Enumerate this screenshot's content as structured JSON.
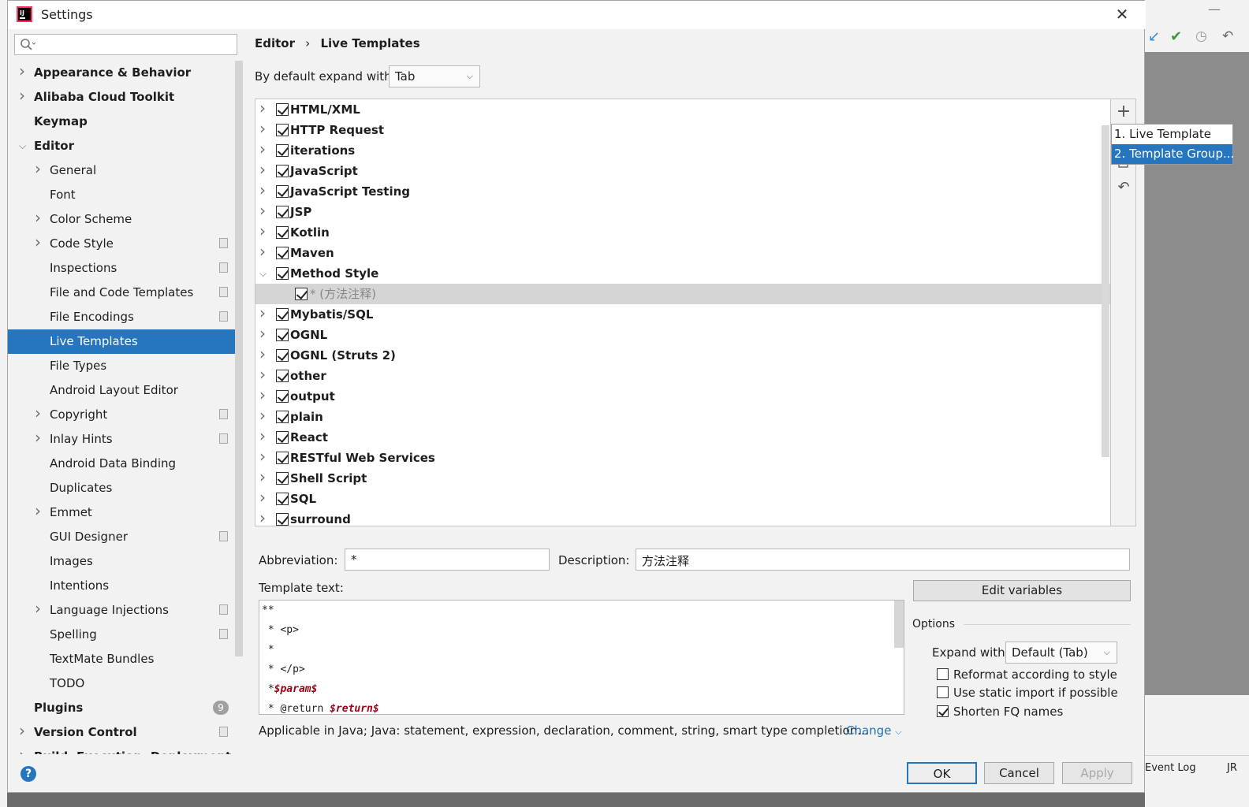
{
  "window": {
    "title": "Settings"
  },
  "search": {
    "placeholder": ""
  },
  "sidebar": {
    "items": [
      {
        "label": "Appearance & Behavior",
        "level": 0,
        "bold": true,
        "chevron": "right"
      },
      {
        "label": "Alibaba Cloud Toolkit",
        "level": 0,
        "bold": true,
        "chevron": "right"
      },
      {
        "label": "Keymap",
        "level": 0,
        "bold": true,
        "chevron": ""
      },
      {
        "label": "Editor",
        "level": 0,
        "bold": true,
        "chevron": "down"
      },
      {
        "label": "General",
        "level": 1,
        "chevron": "right"
      },
      {
        "label": "Font",
        "level": 1,
        "chevron": ""
      },
      {
        "label": "Color Scheme",
        "level": 1,
        "chevron": "right"
      },
      {
        "label": "Code Style",
        "level": 1,
        "chevron": "right",
        "project": true
      },
      {
        "label": "Inspections",
        "level": 1,
        "chevron": "",
        "project": true
      },
      {
        "label": "File and Code Templates",
        "level": 1,
        "chevron": "",
        "project": true
      },
      {
        "label": "File Encodings",
        "level": 1,
        "chevron": "",
        "project": true
      },
      {
        "label": "Live Templates",
        "level": 1,
        "chevron": "",
        "selected": true
      },
      {
        "label": "File Types",
        "level": 1,
        "chevron": ""
      },
      {
        "label": "Android Layout Editor",
        "level": 1,
        "chevron": ""
      },
      {
        "label": "Copyright",
        "level": 1,
        "chevron": "right",
        "project": true
      },
      {
        "label": "Inlay Hints",
        "level": 1,
        "chevron": "right",
        "project": true
      },
      {
        "label": "Android Data Binding",
        "level": 1,
        "chevron": ""
      },
      {
        "label": "Duplicates",
        "level": 1,
        "chevron": ""
      },
      {
        "label": "Emmet",
        "level": 1,
        "chevron": "right"
      },
      {
        "label": "GUI Designer",
        "level": 1,
        "chevron": "",
        "project": true
      },
      {
        "label": "Images",
        "level": 1,
        "chevron": ""
      },
      {
        "label": "Intentions",
        "level": 1,
        "chevron": ""
      },
      {
        "label": "Language Injections",
        "level": 1,
        "chevron": "right",
        "project": true
      },
      {
        "label": "Spelling",
        "level": 1,
        "chevron": "",
        "project": true
      },
      {
        "label": "TextMate Bundles",
        "level": 1,
        "chevron": ""
      },
      {
        "label": "TODO",
        "level": 1,
        "chevron": ""
      },
      {
        "label": "Plugins",
        "level": 0,
        "bold": true,
        "chevron": "",
        "badge": "9"
      },
      {
        "label": "Version Control",
        "level": 0,
        "bold": true,
        "chevron": "right",
        "project": true
      },
      {
        "label": "Build, Execution, Deployment",
        "level": 0,
        "bold": true,
        "chevron": "right"
      }
    ]
  },
  "main": {
    "breadcrumb": {
      "parent": "Editor",
      "separator": "›",
      "current": "Live Templates"
    },
    "expand_label": "By default expand with",
    "expand_value": "Tab",
    "tree": [
      {
        "label": "HTML/XML",
        "expanded": false
      },
      {
        "label": "HTTP Request",
        "expanded": false
      },
      {
        "label": "iterations",
        "expanded": false
      },
      {
        "label": "JavaScript",
        "expanded": false
      },
      {
        "label": "JavaScript Testing",
        "expanded": false
      },
      {
        "label": "JSP",
        "expanded": false
      },
      {
        "label": "Kotlin",
        "expanded": false
      },
      {
        "label": "Maven",
        "expanded": false
      },
      {
        "label": "Method Style",
        "expanded": true
      },
      {
        "label": "* (方法注释)",
        "child": true
      },
      {
        "label": "Mybatis/SQL",
        "expanded": false
      },
      {
        "label": "OGNL",
        "expanded": false
      },
      {
        "label": "OGNL (Struts 2)",
        "expanded": false
      },
      {
        "label": "other",
        "expanded": false
      },
      {
        "label": "output",
        "expanded": false
      },
      {
        "label": "plain",
        "expanded": false
      },
      {
        "label": "React",
        "expanded": false
      },
      {
        "label": "RESTful Web Services",
        "expanded": false
      },
      {
        "label": "Shell Script",
        "expanded": false
      },
      {
        "label": "SQL",
        "expanded": false
      },
      {
        "label": "surround",
        "expanded": false
      }
    ],
    "popup_menu": [
      "1. Live Template",
      "2. Template Group..."
    ],
    "abbreviation_label": "Abbreviation:",
    "abbreviation_value": "*",
    "description_label": "Description:",
    "description_value": "方法注释",
    "template_text_label": "Template text:",
    "template_lines": [
      [
        {
          "t": "**"
        }
      ],
      [
        {
          "t": " * <p>"
        }
      ],
      [
        {
          "t": " *"
        }
      ],
      [
        {
          "t": " * </p>"
        }
      ],
      [
        {
          "t": " *"
        },
        {
          "t": "$param$",
          "var": true
        }
      ],
      [
        {
          "t": " * @return "
        },
        {
          "t": "$return$",
          "var": true
        }
      ]
    ],
    "edit_variables_label": "Edit variables",
    "options_label": "Options",
    "expand_with_label": "Expand with",
    "expand_with_value": "Default (Tab)",
    "options": [
      {
        "label": "Reformat according to style",
        "checked": false
      },
      {
        "label": "Use static import if possible",
        "checked": false
      },
      {
        "label": "Shorten FQ names",
        "checked": true
      }
    ],
    "applicable_text": "Applicable in Java; Java: statement, expression, declaration, comment, string, smart type completion...",
    "change_link": "Change"
  },
  "buttons": {
    "ok": "OK",
    "cancel": "Cancel",
    "apply": "Apply"
  },
  "ide": {
    "event_log": "Event Log",
    "jr": "JR"
  },
  "colors": {
    "accent": "#2675bf",
    "selection": "#2675bf",
    "template_var": "#9b0014"
  },
  "icons": {
    "app": "intellij-logo-icon",
    "search": "search-icon",
    "close": "close-icon",
    "add": "plus-icon",
    "copy": "copy-icon",
    "revert": "revert-icon",
    "help": "help-icon"
  }
}
